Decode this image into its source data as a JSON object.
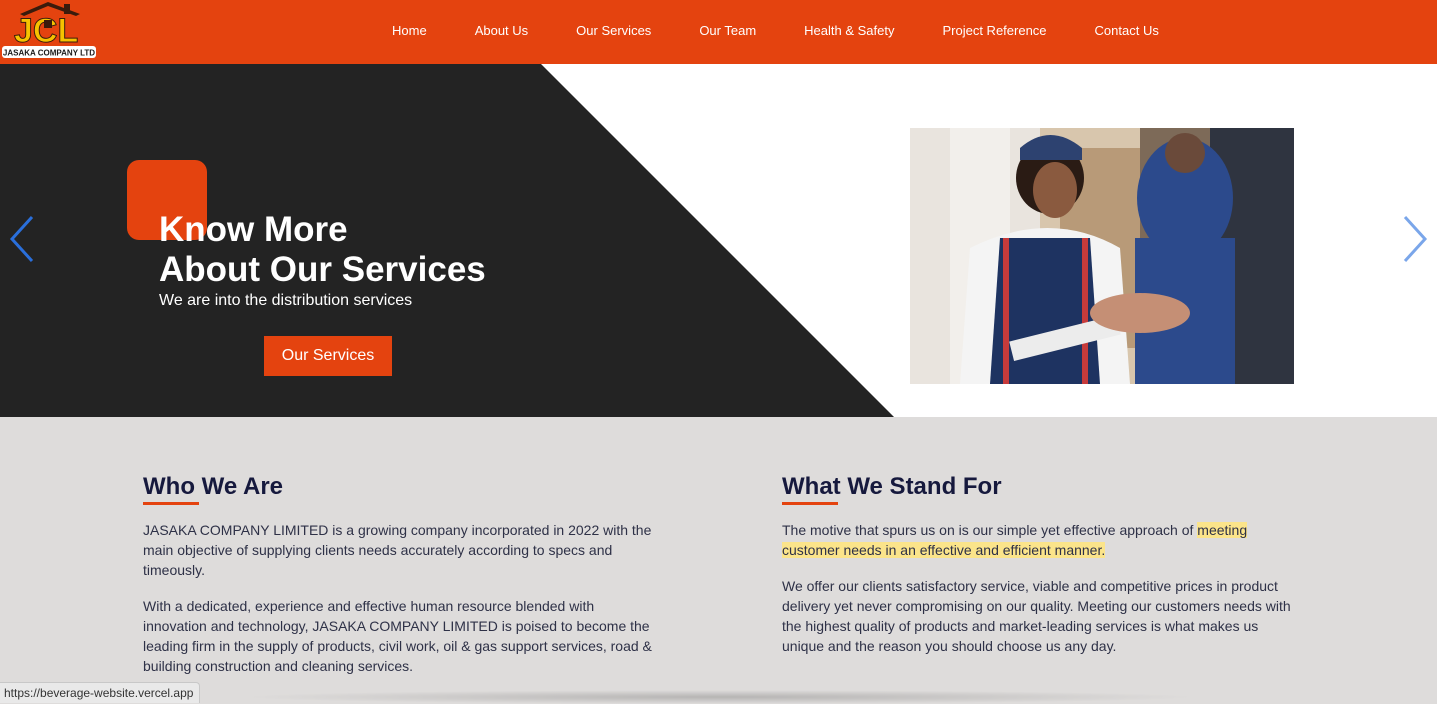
{
  "logo": {
    "letters": "JCL",
    "company": "JASAKA COMPANY LTD"
  },
  "nav": {
    "items": [
      "Home",
      "About Us",
      "Our Services",
      "Our Team",
      "Health & Safety",
      "Project Reference",
      "Contact Us"
    ]
  },
  "hero": {
    "title_line1": "Know More",
    "title_line2": "About Our Services",
    "subtitle": "We are into the distribution services",
    "button_label": "Our Services"
  },
  "who": {
    "heading": "Who We Are",
    "p1": "JASAKA COMPANY LIMITED is a growing company incorporated in 2022 with the main objective of supplying clients needs accurately according to specs and timeously.",
    "p2": "With a dedicated, experience and effective human resource blended with innovation and technology, JASAKA COMPANY LIMITED is poised to become the leading firm in the supply of products, civil work, oil & gas support services, road & building construction and cleaning services."
  },
  "stand": {
    "heading": "What We Stand For",
    "p1_start": "The motive that spurs us on is our simple yet effective approach of ",
    "p1_highlight": "meeting customer needs in an effective and efficient manner.",
    "p2": "We offer our clients satisfactory service, viable and competitive prices in product delivery yet never compromising on our quality. Meeting our customers needs with the highest quality of products and market-leading services is what makes us unique and the reason you should choose us any day."
  },
  "status_url": "https://beverage-website.vercel.app",
  "colors": {
    "brand": "#e4430f",
    "dark": "#232323",
    "heading": "#16193d",
    "highlight": "#fbe48a",
    "arrow": "#2a6fdb"
  }
}
